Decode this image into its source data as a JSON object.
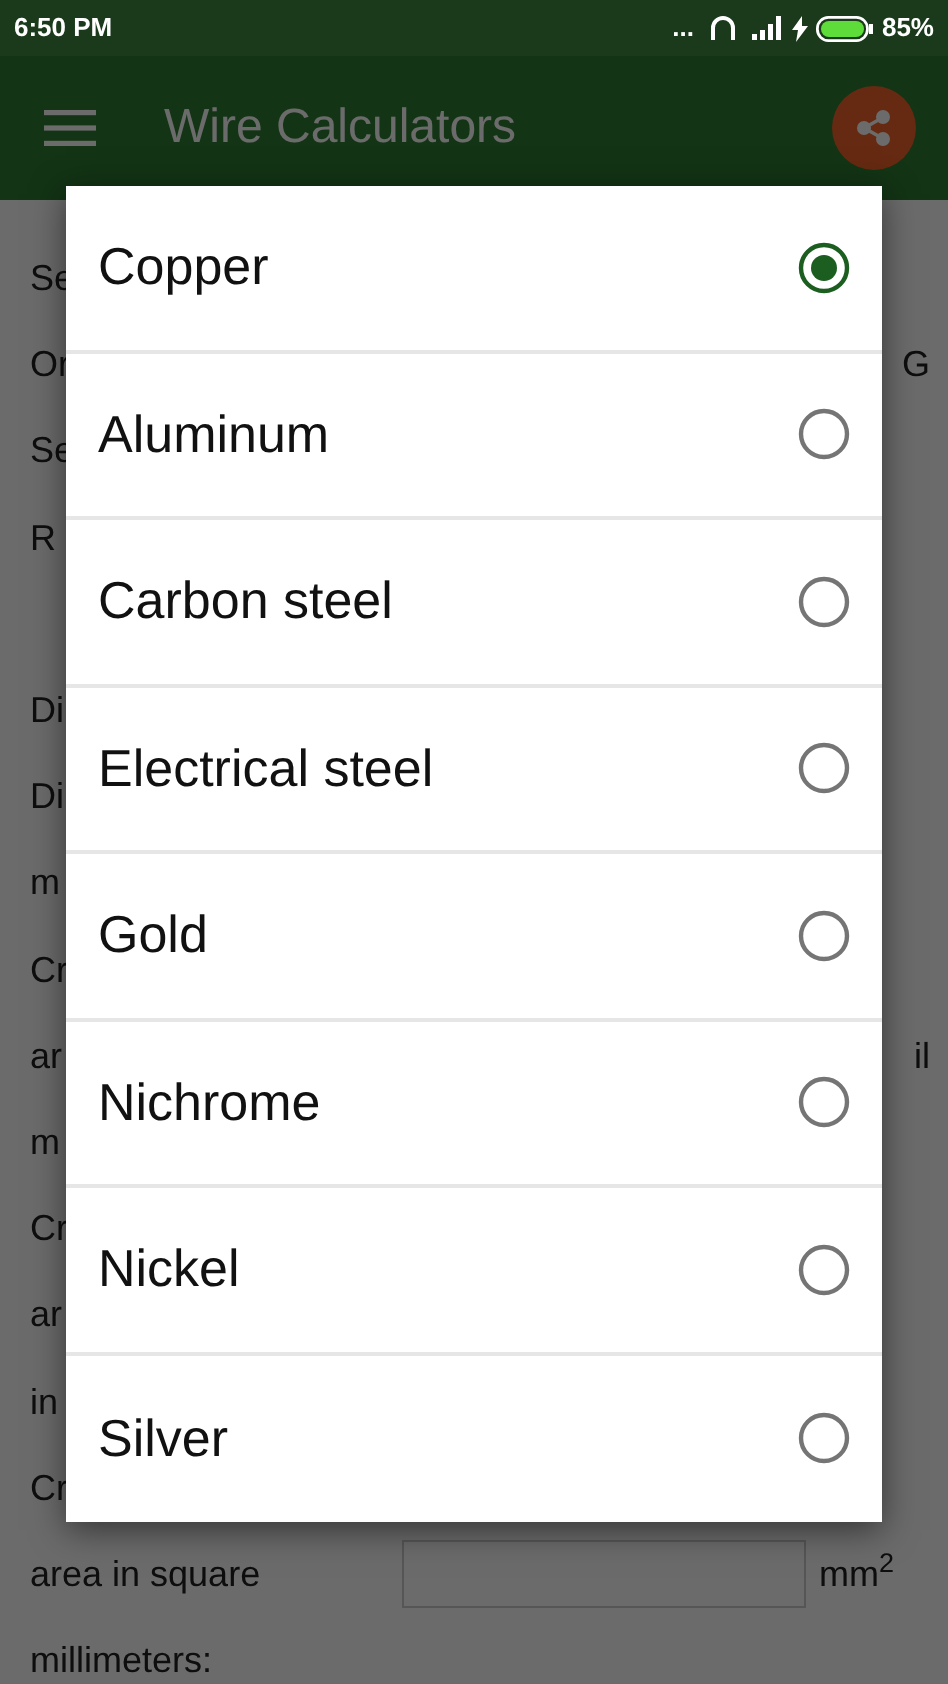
{
  "status_bar": {
    "time": "6:50 PM",
    "dots": "...",
    "battery_text": "85%"
  },
  "toolbar": {
    "title": "Wire Calculators"
  },
  "form_rows": [
    {
      "kind": "line",
      "label": "Se"
    },
    {
      "kind": "line",
      "label": "Or",
      "right": "G"
    },
    {
      "kind": "line",
      "label": "Se"
    },
    {
      "kind": "line",
      "label": "R"
    },
    {
      "kind": "spacer"
    },
    {
      "kind": "line",
      "label": "Di"
    },
    {
      "kind": "line",
      "label": "Di"
    },
    {
      "kind": "line",
      "label": "m"
    },
    {
      "kind": "line",
      "label": "Cr"
    },
    {
      "kind": "line",
      "label": "ar",
      "right": "il"
    },
    {
      "kind": "line",
      "label": "m"
    },
    {
      "kind": "line",
      "label": "Cr"
    },
    {
      "kind": "line",
      "label": "ar"
    },
    {
      "kind": "line",
      "label": "in"
    },
    {
      "kind": "line",
      "label": "Cr"
    },
    {
      "kind": "field",
      "label": "area in square",
      "unit": "mm$^{2}$"
    },
    {
      "kind": "line",
      "label": "millimeters:"
    }
  ],
  "dialog": {
    "options": [
      {
        "label": "Copper",
        "selected": true
      },
      {
        "label": "Aluminum",
        "selected": false
      },
      {
        "label": "Carbon steel",
        "selected": false
      },
      {
        "label": "Electrical steel",
        "selected": false
      },
      {
        "label": "Gold",
        "selected": false
      },
      {
        "label": "Nichrome",
        "selected": false
      },
      {
        "label": "Nickel",
        "selected": false
      },
      {
        "label": "Silver",
        "selected": false
      }
    ]
  }
}
